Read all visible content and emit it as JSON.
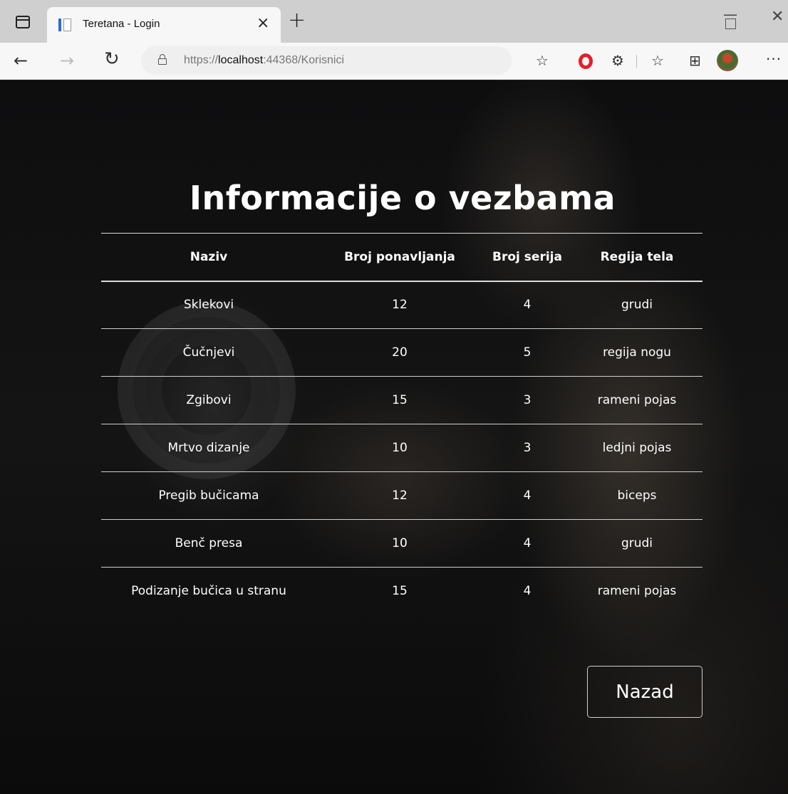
{
  "browser": {
    "tab_title": "Teretana - Login",
    "url_scheme": "https://",
    "url_host": "localhost",
    "url_rest": ":44368/Korisnici",
    "icons": [
      "tab-actions-icon",
      "tab-favicon",
      "close-icon",
      "plus-icon",
      "minimize-icon",
      "maximize-icon",
      "close-window-icon",
      "back-arrow-icon",
      "forward-arrow-icon",
      "refresh-icon",
      "lock-icon",
      "add-favorite-icon",
      "opera-icon",
      "extensions-icon",
      "favorites-icon",
      "collections-icon",
      "profile-avatar",
      "more-icon"
    ]
  },
  "page": {
    "heading": "Informacije o vezbama",
    "table": {
      "headers": [
        "Naziv",
        "Broj ponavljanja",
        "Broj serija",
        "Regija tela"
      ],
      "rows": [
        [
          "Sklekovi",
          "12",
          "4",
          "grudi"
        ],
        [
          "Čučnjevi",
          "20",
          "5",
          "regija nogu"
        ],
        [
          "Zgibovi",
          "15",
          "3",
          "rameni pojas"
        ],
        [
          "Mrtvo dizanje",
          "10",
          "3",
          "ledjni pojas"
        ],
        [
          "Pregib bučicama",
          "12",
          "4",
          "biceps"
        ],
        [
          "Benč presa",
          "10",
          "4",
          "grudi"
        ],
        [
          "Podizanje bučica u stranu",
          "15",
          "4",
          "rameni pojas"
        ]
      ]
    },
    "back_button": "Nazad"
  },
  "colors": {
    "text": "#ffffff",
    "background": "#111111",
    "accent_opera": "#e61e2a"
  }
}
